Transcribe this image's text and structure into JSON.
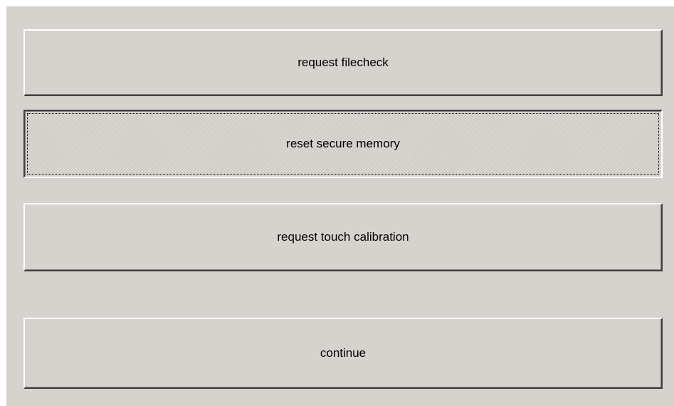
{
  "buttons": {
    "request_filecheck": "request filecheck",
    "reset_secure_memory": "reset secure memory",
    "request_touch_calibration": "request touch calibration",
    "continue": "continue"
  },
  "colors": {
    "face": "#d6d3ce",
    "highlight": "#ffffff",
    "shadow": "#404040"
  },
  "state": {
    "focused_button": "reset secure memory"
  }
}
